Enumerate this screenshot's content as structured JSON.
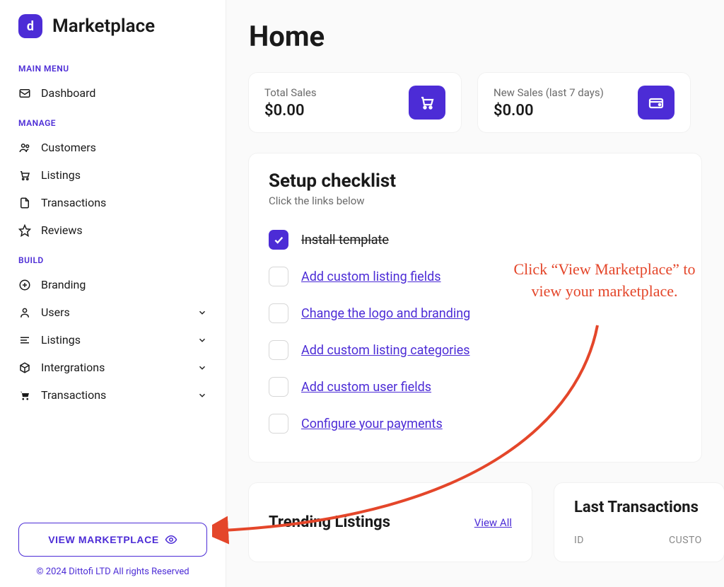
{
  "brand": {
    "name": "Marketplace",
    "logo_letter": "d"
  },
  "sidebar": {
    "sections": {
      "main_menu": "MAIN MENU",
      "manage": "MANAGE",
      "build": "BUILD"
    },
    "items": {
      "dashboard": "Dashboard",
      "customers": "Customers",
      "listings": "Listings",
      "transactions": "Transactions",
      "reviews": "Reviews",
      "branding": "Branding",
      "users": "Users",
      "build_listings": "Listings",
      "integrations": "Intergrations",
      "build_transactions": "Transactions"
    },
    "view_marketplace": "VIEW MARKETPLACE",
    "copyright": "© 2024 Dittofi LTD All rights Reserved"
  },
  "page": {
    "title": "Home",
    "stats": {
      "total_sales": {
        "label": "Total Sales",
        "value": "$0.00"
      },
      "new_sales": {
        "label": "New Sales (last 7 days)",
        "value": "$0.00"
      }
    },
    "checklist": {
      "title": "Setup checklist",
      "subtitle": "Click the links below",
      "items": [
        {
          "label": "Install template",
          "done": true
        },
        {
          "label": "Add custom listing fields",
          "done": false
        },
        {
          "label": "Change the logo and branding",
          "done": false
        },
        {
          "label": "Add custom listing categories",
          "done": false
        },
        {
          "label": "Add custom user fields",
          "done": false
        },
        {
          "label": "Configure your payments",
          "done": false
        }
      ]
    },
    "trending": {
      "title": "Trending Listings",
      "view_all": "View All"
    },
    "last_transactions": {
      "title": "Last Transactions",
      "columns": {
        "id": "ID",
        "customer": "CUSTO"
      }
    }
  },
  "annotation": "Click “View Marketplace” to view your marketplace."
}
